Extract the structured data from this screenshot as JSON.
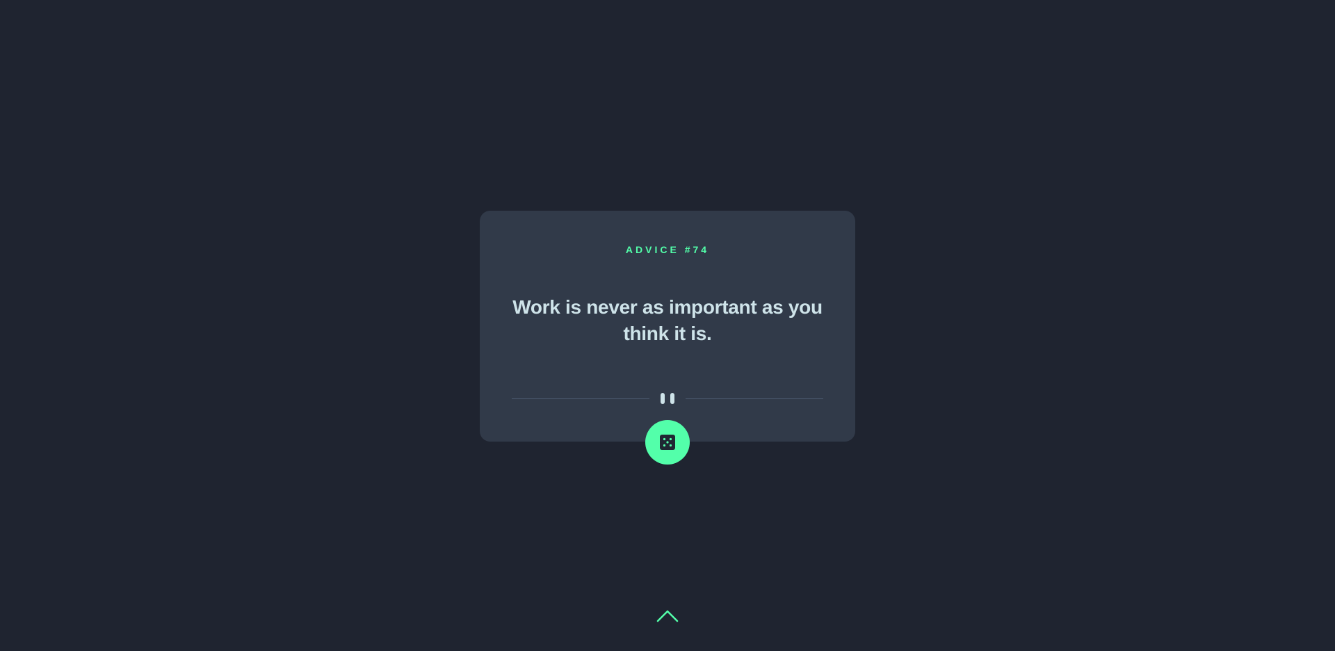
{
  "advice": {
    "id_label": "ADVICE #74",
    "text": "Work is never as important as you think it is."
  },
  "icons": {
    "divider": "pause-icon",
    "dice": "dice-icon",
    "scroll": "chevron-up-icon"
  },
  "colors": {
    "background": "#1f2430",
    "card": "#313a49",
    "accent": "#53ffaa",
    "text": "#cee3e9",
    "divider": "#4f5d74"
  }
}
